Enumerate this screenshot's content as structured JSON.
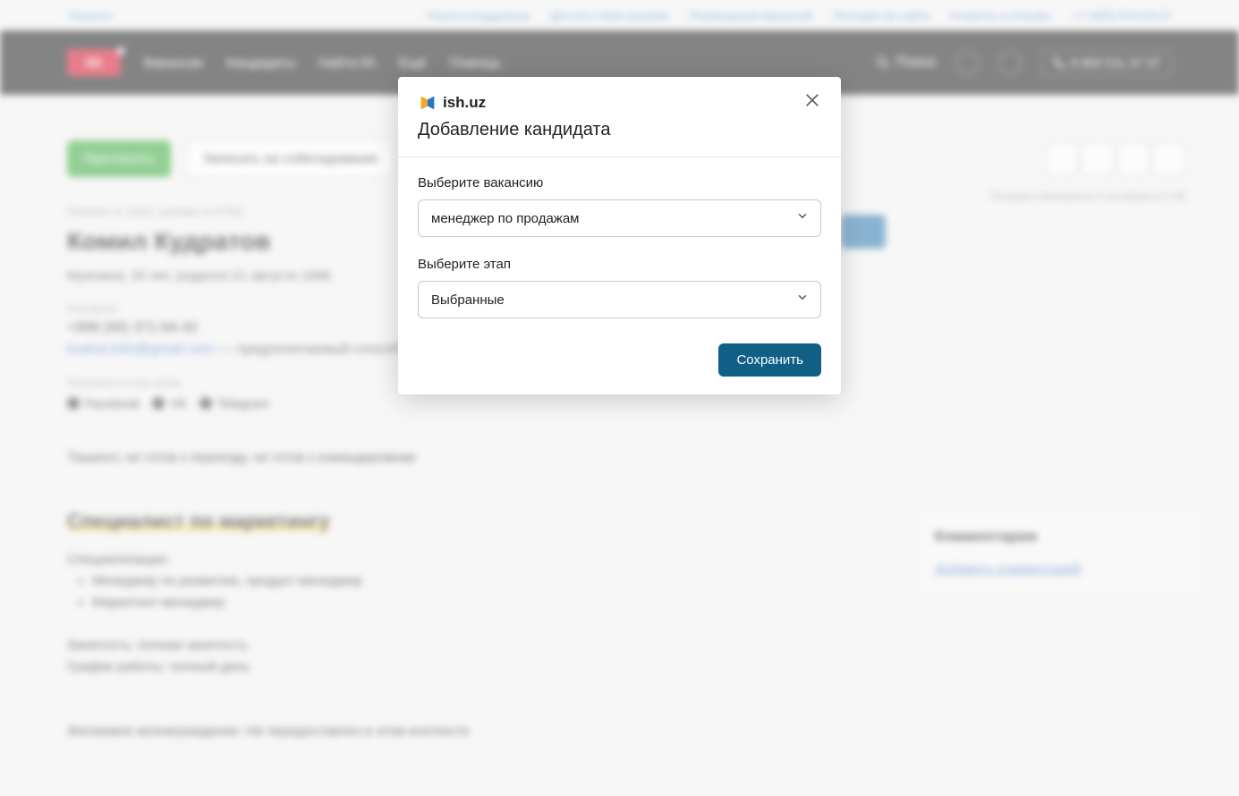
{
  "topbar": {
    "left": "Ташкент",
    "links": [
      "Поиск сотрудников",
      "Доступ к базе резюме",
      "Размещение вакансий",
      "Реклама на сайте",
      "Клиенты и отзывы",
      "+7 (495) 974-64-27"
    ]
  },
  "navbar": {
    "items": [
      "Вакансии",
      "Кандидаты",
      "Haйти.hh",
      "Ещё",
      "Помощь"
    ],
    "search": "Поиск",
    "phone": "8 800 511 37 37"
  },
  "page": {
    "btn_invite": "Пригласить",
    "btn_interview": "Записать на собеседование",
    "crumb": "Резюме от 2020, резюме в HTML",
    "name": "Комил Кудратов",
    "meta": "Мужчина, 25 лет, родился 21 августа 1998",
    "contacts_label": "Контакты",
    "phone": "+998 (90) 371-64-42",
    "email": "kudrat.fofo@gmail.com",
    "pref": "— предпочитаемый способ связи",
    "social_label": "Контакты в соц сетях",
    "socials": [
      "Facebook",
      "VK",
      "Telegram"
    ],
    "note": "Ташкент, не готов к переезду, не готов к командировкам",
    "jobtitle": "Специалист по маркетингу",
    "spec_label": "Специализации:",
    "specs": [
      "Менеджер по развитию, продукт-менеджер",
      "Маркетинг-менеджер"
    ],
    "employment": "Занятость: полная занятость",
    "schedule": "График работы: полный день",
    "note2": "Желаемое вознаграждение: Не передоставлен в этом контексте",
    "icons_tip": "",
    "updated": "Резюме обновлено 4 октября в 2:39"
  },
  "comments": {
    "title": "Комментарии",
    "link": "Добавить комментарий"
  },
  "modal": {
    "brand": "ish.uz",
    "title": "Добавление кандидата",
    "label_vacancy": "Выберите вакансию",
    "value_vacancy": "менеджер по продажам",
    "label_stage": "Выберите этап",
    "value_stage": "Выбранные",
    "save": "Сохранить"
  }
}
